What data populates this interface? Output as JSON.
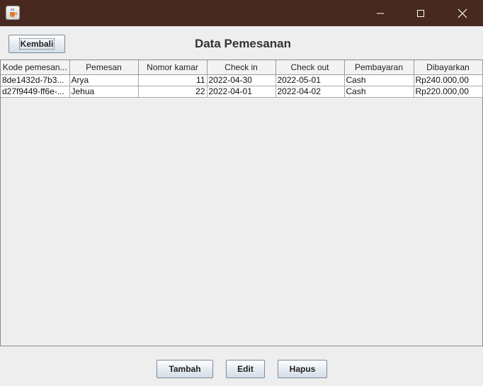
{
  "titlebar": {
    "app_icon": "java-cup-icon"
  },
  "header": {
    "back_label": "Kembali",
    "title": "Data Pemesanan"
  },
  "table": {
    "columns": [
      "Kode pemesan...",
      "Pemesan",
      "Nomor kamar",
      "Check in",
      "Check out",
      "Pembayaran",
      "Dibayarkan"
    ],
    "rows": [
      [
        "8de1432d-7b3...",
        "Arya",
        "11",
        "2022-04-30",
        "2022-05-01",
        "Cash",
        "Rp240.000,00"
      ],
      [
        "d27f9449-ff6e-...",
        "Jehua",
        "22",
        "2022-04-01",
        "2022-04-02",
        "Cash",
        "Rp220.000,00"
      ]
    ]
  },
  "actions": {
    "add_label": "Tambah",
    "edit_label": "Edit",
    "delete_label": "Hapus"
  }
}
